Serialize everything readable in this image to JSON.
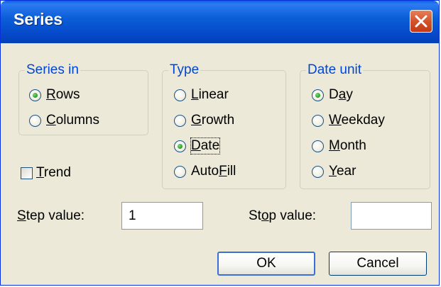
{
  "window": {
    "title": "Series"
  },
  "series_in": {
    "label": "Series in",
    "options": [
      {
        "pre": "",
        "key": "R",
        "post": "ows",
        "checked": true
      },
      {
        "pre": "",
        "key": "C",
        "post": "olumns",
        "checked": false
      }
    ]
  },
  "type": {
    "label": "Type",
    "options": [
      {
        "pre": "",
        "key": "L",
        "post": "inear",
        "checked": false
      },
      {
        "pre": "",
        "key": "G",
        "post": "rowth",
        "checked": false
      },
      {
        "pre": "",
        "key": "D",
        "post": "ate",
        "checked": true
      },
      {
        "pre": "Auto",
        "key": "F",
        "post": "ill",
        "checked": false
      }
    ]
  },
  "date_unit": {
    "label": "Date unit",
    "options": [
      {
        "pre": "D",
        "key": "a",
        "post": "y",
        "checked": true
      },
      {
        "pre": "",
        "key": "W",
        "post": "eekday",
        "checked": false
      },
      {
        "pre": "",
        "key": "M",
        "post": "onth",
        "checked": false
      },
      {
        "pre": "",
        "key": "Y",
        "post": "ear",
        "checked": false
      }
    ]
  },
  "trend": {
    "pre": "",
    "key": "T",
    "post": "rend",
    "checked": false
  },
  "step": {
    "pre": "",
    "key": "S",
    "post": "tep value:",
    "value": "1"
  },
  "stop": {
    "pre": "St",
    "key": "o",
    "post": "p value:",
    "value": ""
  },
  "buttons": {
    "ok": "OK",
    "cancel": "Cancel"
  }
}
